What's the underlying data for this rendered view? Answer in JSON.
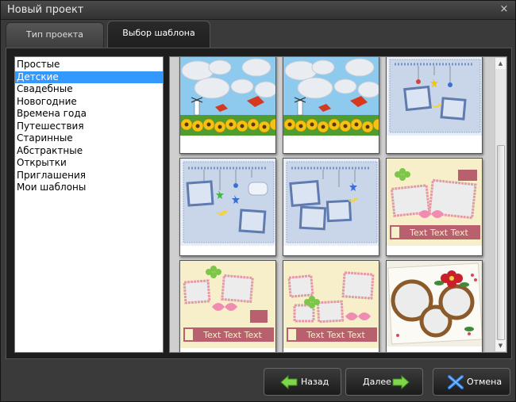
{
  "window": {
    "title": "Новый проект",
    "close_glyph": "×"
  },
  "tabs": [
    {
      "label": "Тип проекта",
      "active": false
    },
    {
      "label": "Выбор шаблона",
      "active": true
    }
  ],
  "categories": [
    {
      "label": "Простые",
      "selected": false
    },
    {
      "label": "Детские",
      "selected": true
    },
    {
      "label": "Свадебные",
      "selected": false
    },
    {
      "label": "Новогодние",
      "selected": false
    },
    {
      "label": "Времена года",
      "selected": false
    },
    {
      "label": "Путешествия",
      "selected": false
    },
    {
      "label": "Старинные",
      "selected": false
    },
    {
      "label": "Абстрактные",
      "selected": false
    },
    {
      "label": "Открытки",
      "selected": false
    },
    {
      "label": "Приглашения",
      "selected": false
    },
    {
      "label": "Мои шаблоны",
      "selected": false
    }
  ],
  "templates": [
    {
      "theme": "sunflower-clouds",
      "caption": ""
    },
    {
      "theme": "sunflower-clouds",
      "caption": ""
    },
    {
      "theme": "baby-blue-mobile",
      "caption": ""
    },
    {
      "theme": "baby-blue-mobile",
      "caption": ""
    },
    {
      "theme": "baby-blue-mobile",
      "caption": ""
    },
    {
      "theme": "pink-ribbon-frames",
      "caption": "Text Text Text"
    },
    {
      "theme": "pink-ribbon-frames",
      "caption": "Text Text Text"
    },
    {
      "theme": "pink-ribbon-frames",
      "caption": "Text Text Text"
    },
    {
      "theme": "floral-wreath",
      "caption": ""
    }
  ],
  "buttons": {
    "back": {
      "label": "Назад",
      "icon": "arrow-left-icon"
    },
    "next": {
      "label": "Далее",
      "icon": "arrow-right-icon"
    },
    "cancel": {
      "label": "Отмена",
      "icon": "x-cross-icon"
    }
  },
  "colors": {
    "selection": "#3399ff",
    "arrow_green": "#7fd64a",
    "cancel_blue": "#2f7fe0"
  }
}
